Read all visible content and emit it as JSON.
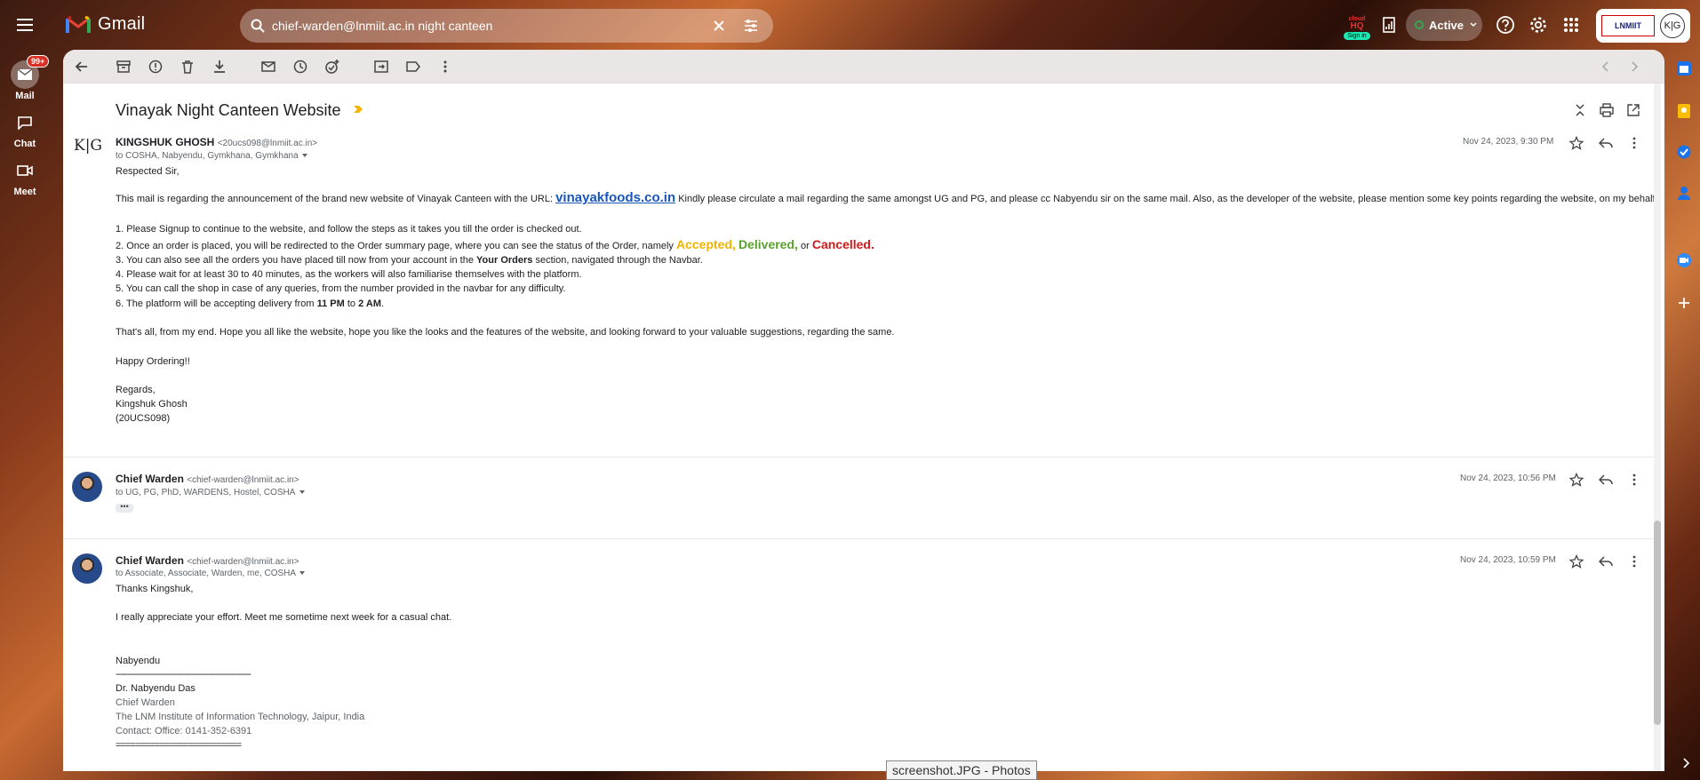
{
  "app": {
    "name": "Gmail"
  },
  "search": {
    "query": "chief-warden@lnmiit.ac.in night canteen"
  },
  "addon": {
    "top": "cloud",
    "mid": "HQ",
    "signin": "Sign in"
  },
  "status": {
    "label": "Active"
  },
  "org": {
    "logo_text": "LNMIIT",
    "avatar_initials": "K|G"
  },
  "rail": {
    "mail": {
      "label": "Mail",
      "badge": "99+"
    },
    "chat": {
      "label": "Chat"
    },
    "meet": {
      "label": "Meet"
    }
  },
  "thread": {
    "subject": "Vinayak Night Canteen Website",
    "messages": [
      {
        "avatar_text": "K|G",
        "sender_name": "KINGSHUK GHOSH",
        "sender_email": "<20ucs098@lnmiit.ac.in>",
        "to": "to COSHA, Nabyendu, Gymkhana, Gymkhana",
        "date": "Nov 24, 2023, 9:30 PM",
        "greeting": "Respected Sir,",
        "intro_before": "This mail is regarding the announcement of the brand new website of Vinayak Canteen with the URL: ",
        "url": "vinayakfoods.co.in",
        "intro_after": " Kindly please circulate a mail regarding the same amongst UG and PG, and please cc Nabyendu sir on the same mail. Also, as the developer of the website, please mention some key points regarding the website, on my behalf:",
        "p1": "1. Please Signup to continue to the website, and follow the steps as it takes you till the order is checked out.",
        "p2_before": "2. Once an order is placed, you will be redirected to the Order summary page, where you can see the status of the Order, namely ",
        "p2_accepted": "Accepted,",
        "p2_delivered": "Delivered,",
        "p2_or": " or ",
        "p2_cancelled": "Cancelled.",
        "p3_before": "3. You can also see all the orders you have placed till now from your account in the ",
        "p3_bold": "Your Orders",
        "p3_after": " section, navigated through the Navbar.",
        "p4": "4. Please wait for at least 30 to 40 minutes, as the workers will also familiarise themselves with the platform.",
        "p5": "5. You can call the shop in case of any queries, from the number provided in the navbar for any difficulty.",
        "p6_before": "6. The platform will be accepting delivery from ",
        "p6_start": "11 PM",
        "p6_to": " to ",
        "p6_end": "2 AM",
        "p6_after": ".",
        "closing": "That's all, from my end. Hope you all like the website, hope you like the looks and the features of the website, and looking forward to your valuable suggestions, regarding the same.",
        "happy": "Happy Ordering!!",
        "regards": "Regards,",
        "sig_name": "Kingshuk Ghosh",
        "sig_roll": "(20UCS098)"
      },
      {
        "sender_name": "Chief Warden",
        "sender_email": "<chief-warden@lnmiit.ac.in>",
        "to": "to UG, PG, PhD, WARDENS, Hostel, COSHA",
        "date": "Nov 24, 2023, 10:56 PM",
        "ellipsis": "•••"
      },
      {
        "sender_name": "Chief Warden",
        "sender_email": "<chief-warden@lnmiit.ac.in>",
        "to": "to Associate, Associate, Warden, me, COSHA",
        "date": "Nov 24, 2023, 10:59 PM",
        "l1": "Thanks Kingshuk,",
        "l2": "I really appreciate your effort.  Meet me sometime next week for a casual chat.",
        "l3": "Nabyendu",
        "l4": "---------------------------------------------------------",
        "l5": "Dr. Nabyendu Das",
        "l6": "Chief Warden",
        "l7": "The LNM Institute of Information Technology, Jaipur, India",
        "l8": "Contact: Office: 0141-352-6391",
        "l9": "=========================="
      }
    ]
  },
  "taskbar_tooltip": "screenshot.JPG - Photos",
  "colors": {
    "accepted": "#f0b400",
    "delivered": "#5aa02c",
    "cancelled": "#d21a1a",
    "link": "#1a56b8",
    "badge": "#d93025",
    "active_dot": "#34a853"
  }
}
